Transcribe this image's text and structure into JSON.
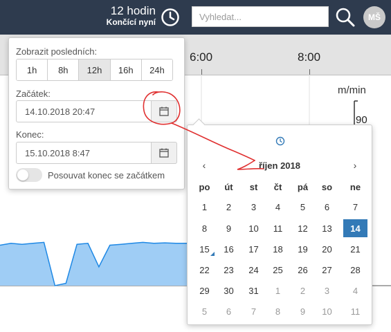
{
  "header": {
    "range_title": "12 hodin",
    "range_subtitle": "Končící nyní",
    "search_placeholder": "Vyhledat...",
    "avatar_initials": "MŠ"
  },
  "timeline": {
    "ticks": [
      "6:00",
      "8:00"
    ]
  },
  "chart": {
    "unit_label": "m/min",
    "y_value": "90"
  },
  "time_picker": {
    "show_last_label": "Zobrazit posledních:",
    "ranges": [
      "1h",
      "8h",
      "12h",
      "16h",
      "24h"
    ],
    "selected_range": "12h",
    "start_label": "Začátek:",
    "start_value": "14.10.2018 20:47",
    "end_label": "Konec:",
    "end_value": "15.10.2018 8:47",
    "move_end_label": "Posouvat konec se začátkem"
  },
  "datepicker": {
    "month_title": "říjen 2018",
    "weekdays": [
      "po",
      "út",
      "st",
      "čt",
      "pá",
      "so",
      "ne"
    ],
    "weeks": [
      [
        "1",
        "2",
        "3",
        "4",
        "5",
        "6",
        "7"
      ],
      [
        "8",
        "9",
        "10",
        "11",
        "12",
        "13",
        "14"
      ],
      [
        "15",
        "16",
        "17",
        "18",
        "19",
        "20",
        "21"
      ],
      [
        "22",
        "23",
        "24",
        "25",
        "26",
        "27",
        "28"
      ],
      [
        "29",
        "30",
        "31",
        "1",
        "2",
        "3",
        "4"
      ],
      [
        "5",
        "6",
        "7",
        "8",
        "9",
        "10",
        "11"
      ]
    ],
    "selected_day": "14",
    "today_day": "15"
  },
  "colors": {
    "topbar": "#2e3b4e",
    "accent": "#337ab7",
    "series_fill": "#9fcdf5",
    "series_line": "#1e88e5",
    "annotation": "#e03030"
  },
  "chart_data": {
    "type": "area",
    "series": [
      {
        "values": [
          0.86,
          0.9,
          0.88,
          0.9,
          0.92,
          0.0,
          0.05,
          0.88,
          0.9,
          0.4,
          0.86,
          0.88,
          0.9,
          0.92,
          0.9,
          0.91,
          0.9,
          0.9
        ]
      }
    ]
  }
}
